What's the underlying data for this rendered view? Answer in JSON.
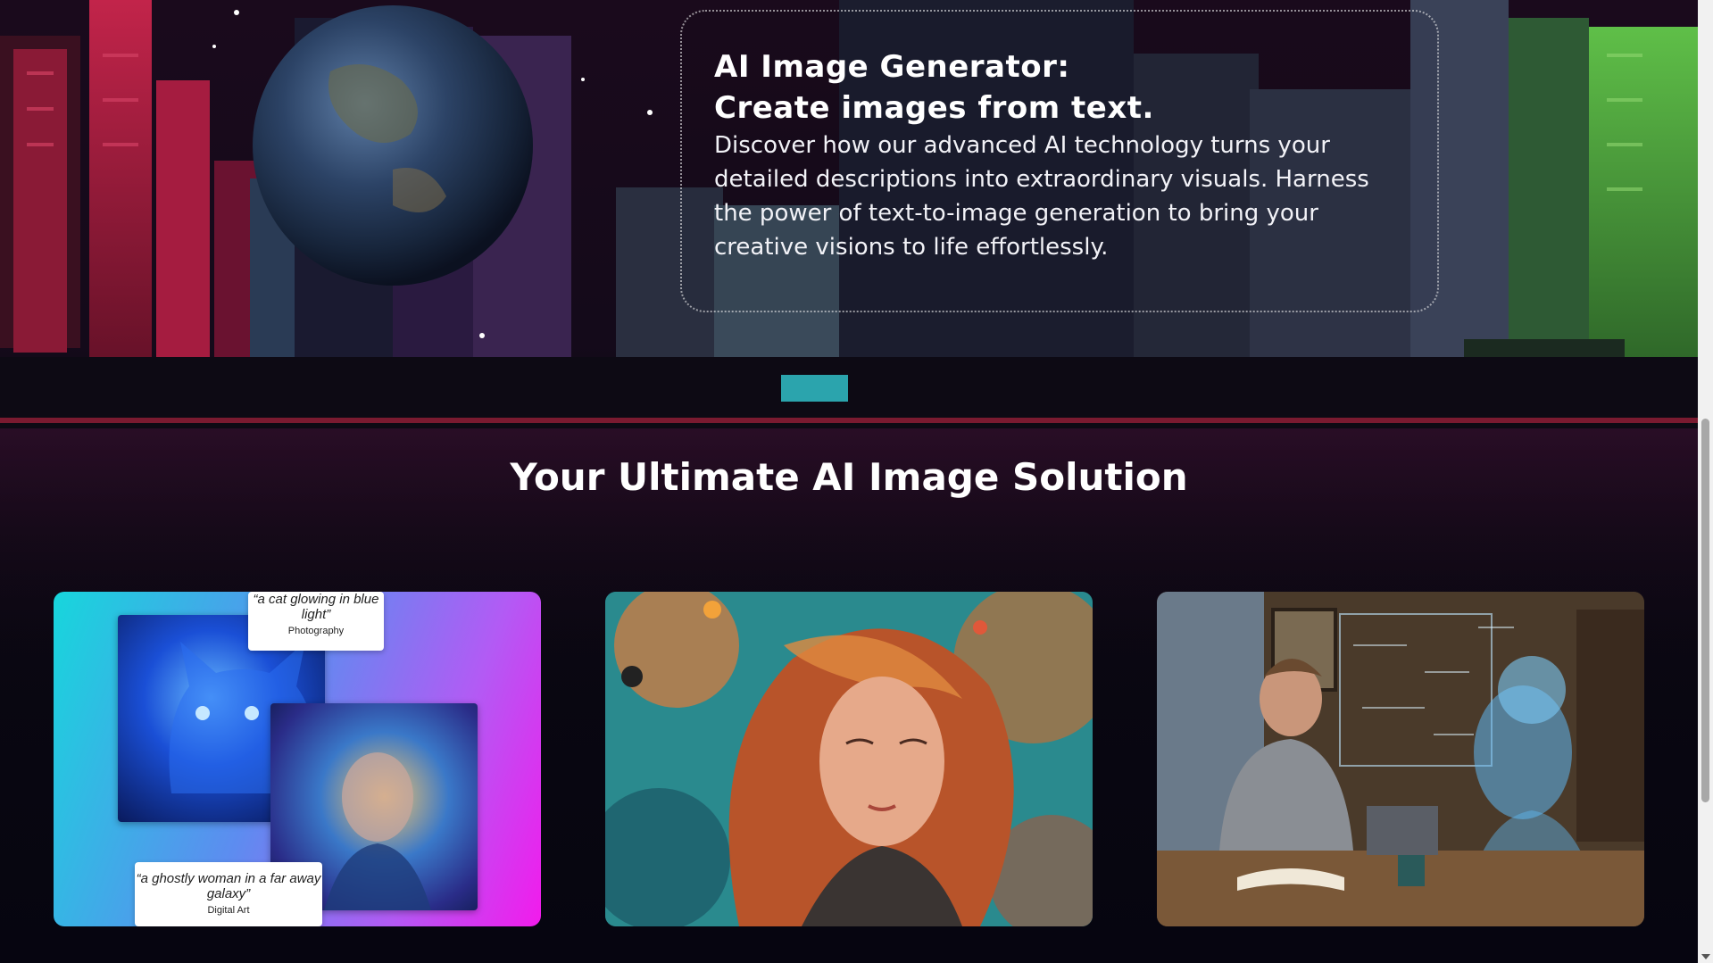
{
  "hero": {
    "title_line1": "AI Image Generator:",
    "title_line2": "Create images from text.",
    "description": "Discover how our advanced AI technology turns your detailed descriptions into extraordinary visuals. Harness the power of text-to-image generation to bring your creative visions to life effortlessly."
  },
  "section": {
    "title": "Your Ultimate AI Image Solution"
  },
  "cards": [
    {
      "labels": [
        {
          "quote": "“a cat glowing in blue light”",
          "category": "Photography"
        },
        {
          "quote": "“a ghostly woman in a far away galaxy”",
          "category": "Digital Art"
        }
      ],
      "gradient": [
        "#17d6dc",
        "#f21bec"
      ]
    },
    {
      "image": "woman-with-swirling-hair-painting"
    },
    {
      "image": "student-with-ai-hologram-illustration"
    }
  ],
  "colors": {
    "background": "#07060f",
    "text": "#ffffff",
    "scrollbar_track": "#f1f1f1",
    "scrollbar_thumb": "#a8a8a8"
  }
}
